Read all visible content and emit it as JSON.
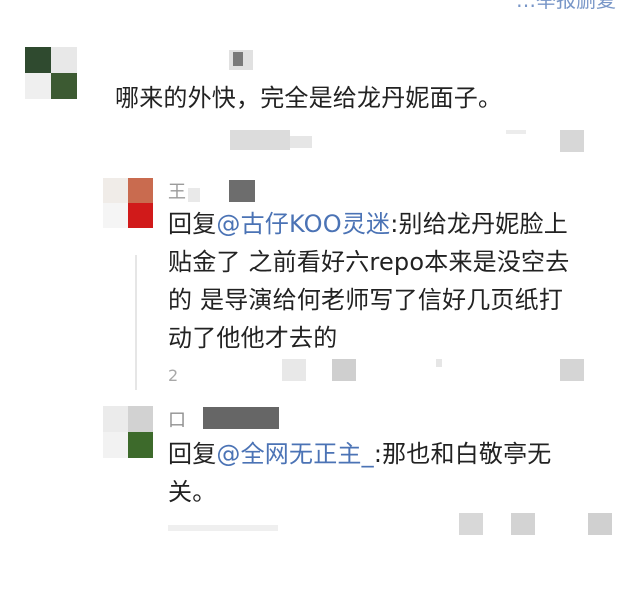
{
  "top_link": "…举报删复",
  "comments": [
    {
      "text": "哪来的外快，完全是给龙丹妮面子。"
    }
  ],
  "replies": [
    {
      "name_hint": "王",
      "prefix": "回复",
      "mention": "@古仔KOO灵迷",
      "body": ":别给龙丹妮脸上贴金了 之前看好六repo本来是没空去的 是导演给何老师写了信好几页纸打动了他他才去的",
      "line1_rest": ":别给龙丹妮脸上",
      "line2": "贴金了 之前看好六repo本来是没空去",
      "line3": "的 是导演给何老师写了信好几页纸打",
      "line4": "动了他他才去的",
      "meta_count": "2"
    },
    {
      "name_hint": "口",
      "prefix": "回复",
      "mention": "@全网无正主_",
      "line1_rest": ":那也和白敬亭无",
      "line2": "关。"
    }
  ]
}
